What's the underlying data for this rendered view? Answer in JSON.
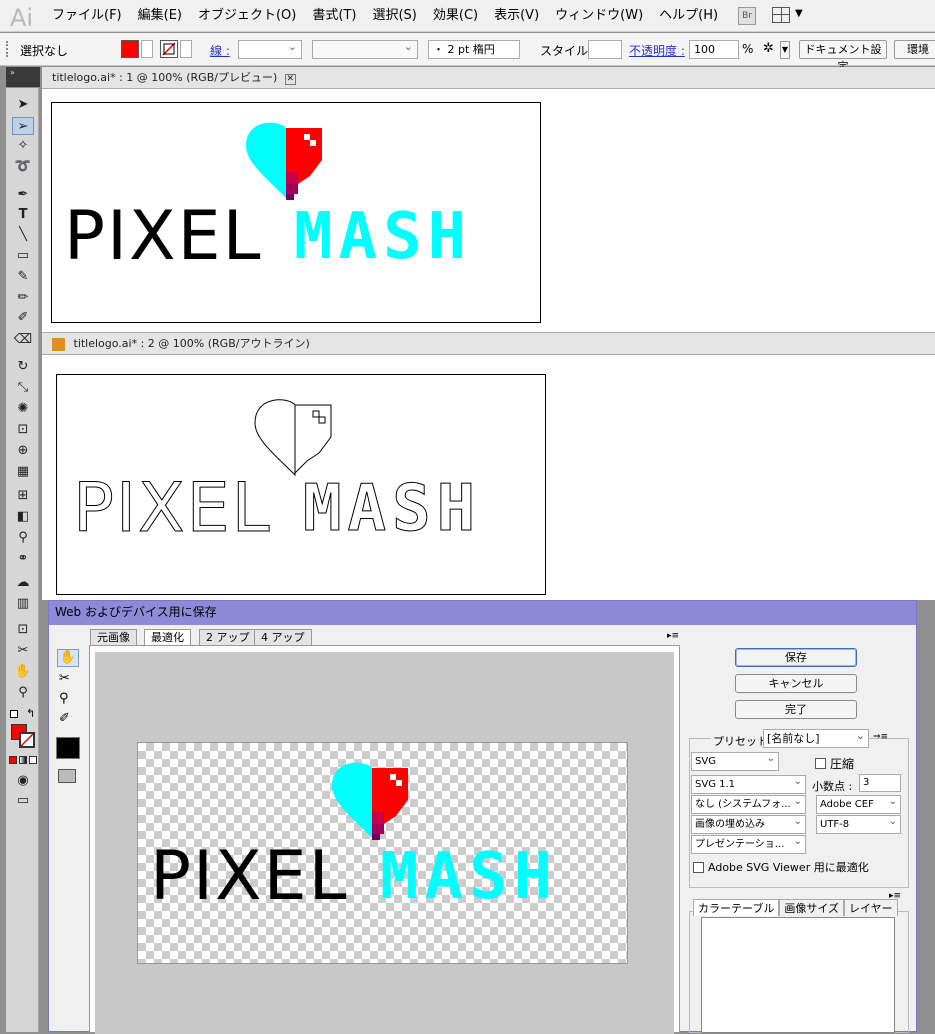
{
  "app": {
    "logo": "Ai"
  },
  "menu": [
    "ファイル(F)",
    "編集(E)",
    "オブジェクト(O)",
    "書式(T)",
    "選択(S)",
    "効果(C)",
    "表示(V)",
    "ウィンドウ(W)",
    "ヘルプ(H)"
  ],
  "menu_extra": {
    "bridge": "Br"
  },
  "control": {
    "selection": "選択なし",
    "stroke_label": "線 :",
    "brush_value": "・ 2 pt 楕円",
    "style_label": "スタイル :",
    "opacity_label": "不透明度 :",
    "opacity_value": "100",
    "percent": "%",
    "doc_settings": "ドキュメント設定",
    "env_settings": "環境"
  },
  "docs": [
    {
      "tab": "titlelogo.ai* : 1 @ 100% (RGB/プレビュー)"
    },
    {
      "tab": "titlelogo.ai* : 2 @ 100% (RGB/アウトライン)"
    }
  ],
  "logo": {
    "word1": "PIXEL",
    "word2": "MASH",
    "word1_color": "#000000",
    "word2_color": "#00ffff",
    "heart_left": "#00ffff",
    "heart_right": "#ff0000"
  },
  "dialog": {
    "title": "Web およびデバイス用に保存",
    "tabs": [
      "元画像",
      "最適化",
      "2 アップ",
      "4 アップ"
    ],
    "active_tab": "最適化",
    "save": "保存",
    "cancel": "キャンセル",
    "done": "完了",
    "preset_label": "プリセット :",
    "preset_value": "[名前なし]",
    "format": "SVG",
    "compress": "圧縮",
    "profile": "SVG 1.1",
    "decimal_label": "小数点 :",
    "decimal_value": "3",
    "font_embed": "なし (システムフォ...",
    "cef": "Adobe CEF",
    "image_mode": "画像の埋め込み",
    "encoding": "UTF-8",
    "css_mode": "プレゼンテーショ...",
    "viewer_opt": "Adobe SVG Viewer 用に最適化",
    "bottom_tabs": [
      "カラーテーブル",
      "画像サイズ",
      "レイヤー"
    ]
  },
  "colors": {
    "fill": "#ff0000",
    "stroke": "none"
  }
}
